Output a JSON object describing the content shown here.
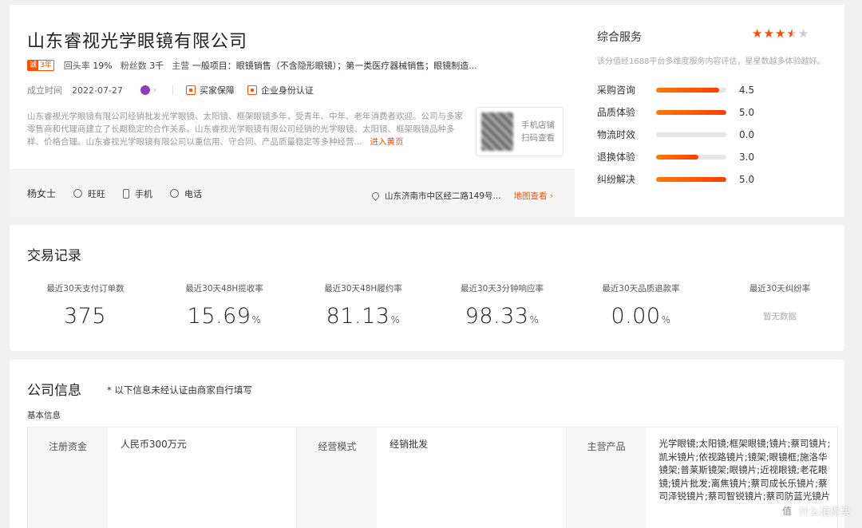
{
  "company": {
    "name": "山东睿视光学眼镜有限公司",
    "badge_1": "诚",
    "badge_2": "3年",
    "return_rate_label": "回头率",
    "return_rate": "19%",
    "fans_label": "粉丝数",
    "fans": "3千",
    "main_business_label": "主营",
    "main_business": "一般项目：眼镜销售（不含隐形眼镜）；第一类医疗器械销售；眼镜制造...",
    "founded_label": "成立时间",
    "founded": "2022-07-27",
    "guarantee": "买家保障",
    "identity": "企业身份认证",
    "description": "山东睿视光学眼镜有限公司经销批发光学眼镜、太阳镜、框架眼镜多年，受青年、中年、老年消费者欢迎。公司与多家零售商和代理商建立了长期稳定的合作关系。山东睿视光学眼镜有限公司经销的光学眼镜、太阳镜、框架眼镜品种多样、价格合理。山东睿视光学眼镜有限公司以重信用、守合同、产品质量稳定等多种经营...",
    "enter_shop": "进入黄页",
    "qr_text": "手机店铺扫码查看"
  },
  "contact": {
    "name": "杨女士",
    "wangwang": "旺旺",
    "mobile": "手机",
    "phone": "电话",
    "address": "山东济南市中区经二路149号...",
    "map_link": "地图查看 ›"
  },
  "service": {
    "title": "综合服务",
    "rating": 3.5,
    "stars": [
      "★",
      "★",
      "★",
      "★",
      "★"
    ],
    "note": "该分值经1688平台多维度服务内容评估，星星数越多体验越好。",
    "items": [
      {
        "label": "采购咨询",
        "value": "4.5",
        "fill": 0.9
      },
      {
        "label": "品质体验",
        "value": "5.0",
        "fill": 1.0
      },
      {
        "label": "物流时效",
        "value": "0.0",
        "fill": 0.0
      },
      {
        "label": "退换体验",
        "value": "3.0",
        "fill": 0.6
      },
      {
        "label": "纠纷解决",
        "value": "5.0",
        "fill": 1.0
      }
    ]
  },
  "trade": {
    "title": "交易记录",
    "stats": [
      {
        "label": "最近30天支付订单数",
        "value": "375",
        "unit": ""
      },
      {
        "label": "最近30天48H揽收率",
        "value": "15.69",
        "unit": "%"
      },
      {
        "label": "最近30天48H履约率",
        "value": "81.13",
        "unit": "%"
      },
      {
        "label": "最近30天3分钟响应率",
        "value": "98.33",
        "unit": "%"
      },
      {
        "label": "最近30天品质退款率",
        "value": "0.00",
        "unit": "%"
      },
      {
        "label": "最近30天纠纷率",
        "value": "",
        "unit": "",
        "empty": "暂无数据"
      }
    ]
  },
  "info": {
    "title": "公司信息",
    "note": "* 以下信息未经认证由商家自行填写",
    "basic_label": "基本信息",
    "rows": [
      {
        "label": "注册资金",
        "value": "人民币300万元"
      },
      {
        "label": "经营模式",
        "value": "经销批发"
      },
      {
        "label": "主营产品",
        "value": "光学眼镜;太阳镜;框架眼镜;镜片;蔡司镜片;凯米镜片;依视路镜片;镜架;眼镜框;施洛华镜架;普莱斯镜架;眼镜片;近视眼镜;老花眼镜;镜片批发;离焦镜片;蔡司成长乐镜片;蔡司泽锐镜片;蔡司智锐镜片;蔡司防蓝光镜片"
      }
    ]
  },
  "watermark": {
    "logo": "值",
    "text": "什么值得买"
  }
}
